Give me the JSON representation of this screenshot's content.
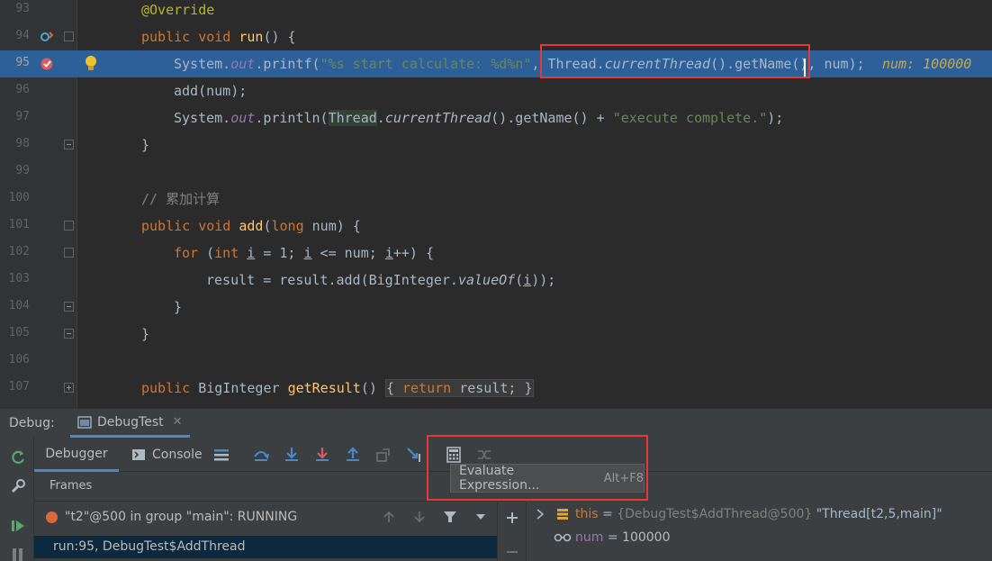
{
  "editor": {
    "lines": [
      {
        "num": "93"
      },
      {
        "num": "94"
      },
      {
        "num": "95"
      },
      {
        "num": "96"
      },
      {
        "num": "97"
      },
      {
        "num": "98"
      },
      {
        "num": "99"
      },
      {
        "num": "100"
      },
      {
        "num": "101"
      },
      {
        "num": "102"
      },
      {
        "num": "103"
      },
      {
        "num": "104"
      },
      {
        "num": "105"
      },
      {
        "num": "106"
      },
      {
        "num": "107"
      }
    ],
    "inline_value": "num: 100000",
    "comment_text": "// 累加计算",
    "override": "@Override"
  },
  "debug": {
    "label": "Debug:",
    "run_tab": "DebugTest",
    "close": "✕",
    "subtabs": {
      "debugger": "Debugger",
      "console": "Console"
    },
    "tooltip": {
      "label": "Evaluate Expression...",
      "shortcut": "Alt+F8"
    },
    "frames_header": "Frames",
    "thread": "\"t2\"@500 in group \"main\": RUNNING",
    "frame": "run:95, DebugTest$AddThread",
    "vars": [
      {
        "name": "this",
        "eq": " = ",
        "value": "{DebugTest$AddThread@500}",
        "extra": " \"Thread[t2,5,main]\""
      },
      {
        "name": "num",
        "eq": " = ",
        "value": "100000",
        "extra": ""
      }
    ]
  },
  "colors": {
    "accent": "#4a88c7",
    "highlight_line": "#2d6099",
    "annotation_box": "#e53935"
  }
}
